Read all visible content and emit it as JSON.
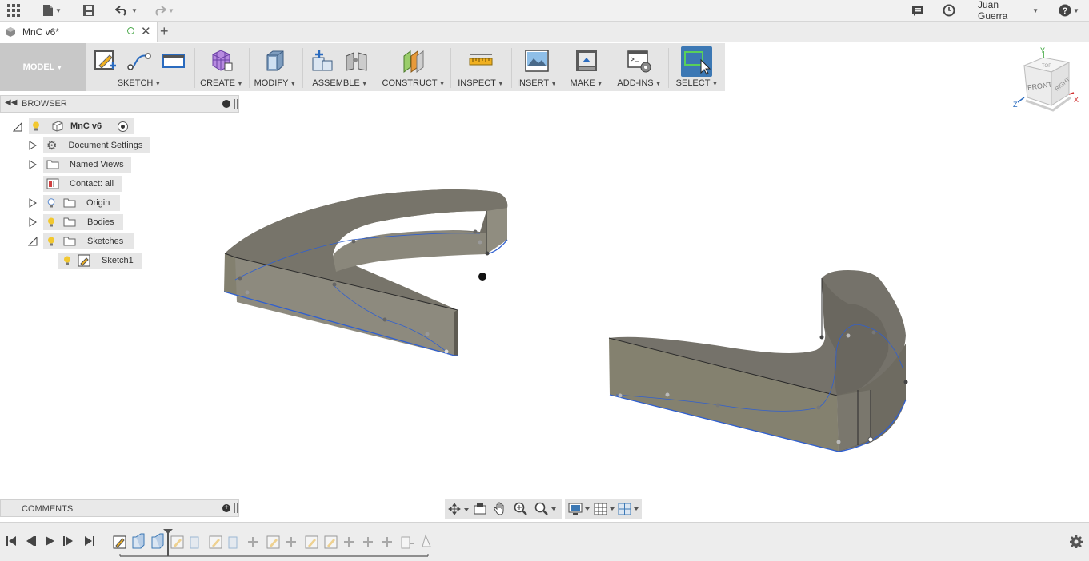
{
  "top_bar": {
    "user_name": "Juan Guerra"
  },
  "document": {
    "tab_title": "MnC v6*"
  },
  "toolbar": {
    "workspace": "MODEL",
    "groups": {
      "sketch": "SKETCH",
      "create": "CREATE",
      "modify": "MODIFY",
      "assemble": "ASSEMBLE",
      "construct": "CONSTRUCT",
      "inspect": "INSPECT",
      "insert": "INSERT",
      "make": "MAKE",
      "addins": "ADD-INS",
      "select": "SELECT"
    }
  },
  "browser": {
    "title": "BROWSER",
    "root": "MnC v6",
    "items": {
      "document_settings": "Document Settings",
      "named_views": "Named Views",
      "contact": "Contact: all",
      "origin": "Origin",
      "bodies": "Bodies",
      "sketches": "Sketches",
      "sketch1": "Sketch1"
    }
  },
  "comments": {
    "title": "COMMENTS"
  },
  "viewcube": {
    "front": "FRONT",
    "right": "RIGHT",
    "top": "TOP",
    "axis_x": "X",
    "axis_y": "Y",
    "axis_z": "Z"
  },
  "colors": {
    "accent_blue": "#3c78b4",
    "body": "#7d7a72",
    "edge_blue": "#2f5fd0"
  }
}
